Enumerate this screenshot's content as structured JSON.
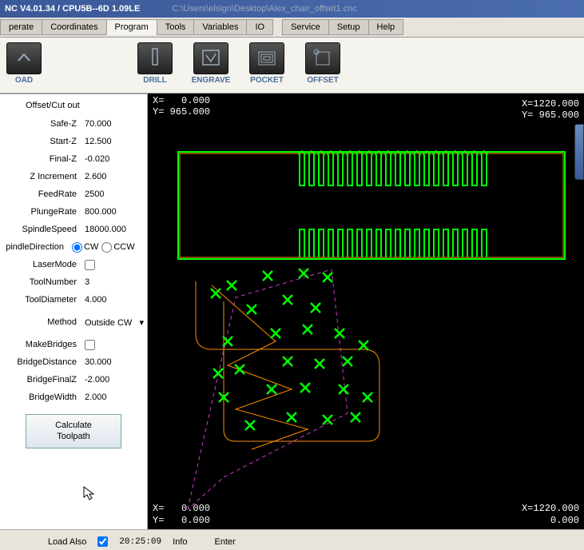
{
  "titlebar": {
    "main": "NC V4.01.34 / CPU5B--6D 1.09LE",
    "path": "C:\\Users\\elsign\\Desktop\\Alex_chair_offset1.cnc"
  },
  "menutabs": {
    "operate": "perate",
    "coordinates": "Coordinates",
    "program": "Program",
    "tools": "Tools",
    "variables": "Variables",
    "io": "IO",
    "service": "Service",
    "setup": "Setup",
    "help": "Help"
  },
  "toolbar": {
    "load": "OAD",
    "drill": "DRILL",
    "engrave": "ENGRAVE",
    "pocket": "POCKET",
    "offset": "OFFSET"
  },
  "sidebar": {
    "header": "Offset/Cut out",
    "safez_lbl": "Safe-Z",
    "safez_val": "70.000",
    "startz_lbl": "Start-Z",
    "startz_val": "12.500",
    "finalz_lbl": "Final-Z",
    "finalz_val": "-0.020",
    "zinc_lbl": "Z Increment",
    "zinc_val": "2.600",
    "feed_lbl": "FeedRate",
    "feed_val": "2500",
    "plunge_lbl": "PlungeRate",
    "plunge_val": "800.000",
    "spindle_lbl": "SpindleSpeed",
    "spindle_val": "18000.000",
    "dir_lbl": "pindleDirection",
    "cw": "CW",
    "ccw": "CCW",
    "laser_lbl": "LaserMode",
    "toolnum_lbl": "ToolNumber",
    "toolnum_val": "3",
    "tooldia_lbl": "ToolDiameter",
    "tooldia_val": "4.000",
    "method_lbl": "Method",
    "method_val": "Outside CW",
    "bridges_lbl": "MakeBridges",
    "bdist_lbl": "BridgeDistance",
    "bdist_val": "30.000",
    "bfz_lbl": "BridgeFinalZ",
    "bfz_val": "-2.000",
    "bw_lbl": "BridgeWidth",
    "bw_val": "2.000",
    "calc": "Calculate\nToolpath"
  },
  "coords": {
    "tl": "X=   0.000\nY= 965.000",
    "tr": "X=1220.000\nY= 965.000",
    "bl": "X=   0.000\nY=   0.000",
    "br": "X=1220.000\n   0.000"
  },
  "status": {
    "load_also": "Load Also",
    "time": "20:25:09",
    "info": "Info",
    "enter": "Enter"
  }
}
